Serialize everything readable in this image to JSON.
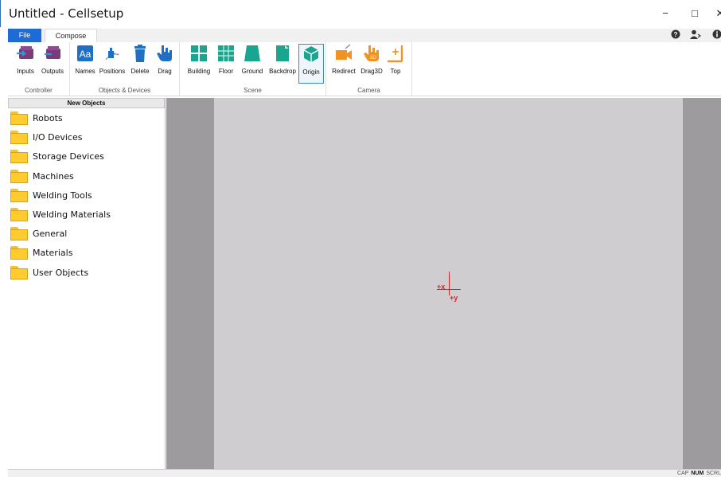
{
  "window": {
    "title": "Untitled - Cellsetup",
    "minimize_glyph": "−",
    "maximize_glyph": "□",
    "close_glyph": "✕"
  },
  "tabs": {
    "file": "File",
    "compose": "Compose"
  },
  "ribbon": {
    "groups": [
      {
        "label": "Controller",
        "buttons": [
          {
            "label": "Inputs",
            "icon": "inputs-icon"
          },
          {
            "label": "Outputs",
            "icon": "outputs-icon"
          }
        ]
      },
      {
        "label": "Objects & Devices",
        "buttons": [
          {
            "label": "Names",
            "icon": "names-icon"
          },
          {
            "label": "Positions",
            "icon": "positions-icon"
          },
          {
            "label": "Delete",
            "icon": "delete-icon"
          },
          {
            "label": "Drag",
            "icon": "drag-icon"
          }
        ]
      },
      {
        "label": "Scene",
        "buttons": [
          {
            "label": "Building",
            "icon": "building-icon"
          },
          {
            "label": "Floor",
            "icon": "floor-icon"
          },
          {
            "label": "Ground",
            "icon": "ground-icon"
          },
          {
            "label": "Backdrop",
            "icon": "backdrop-icon"
          },
          {
            "label": "Origin",
            "icon": "origin-icon",
            "selected": true
          }
        ]
      },
      {
        "label": "Camera",
        "buttons": [
          {
            "label": "Redirect",
            "icon": "redirect-icon"
          },
          {
            "label": "Drag3D",
            "icon": "drag3d-icon"
          },
          {
            "label": "Top",
            "icon": "top-icon"
          }
        ]
      }
    ]
  },
  "left_panel": {
    "header": "New Objects",
    "items": [
      "Robots",
      "I/O Devices",
      "Storage Devices",
      "Machines",
      "Welding Tools",
      "Welding Materials",
      "General",
      "Materials",
      "User Objects"
    ]
  },
  "viewport": {
    "x_axis_label": "+x",
    "y_axis_label": "+y"
  },
  "status": {
    "cap": "CAP",
    "num": "NUM",
    "scrl": "SCRL"
  },
  "colors": {
    "file_tab": "#1c6bd6",
    "teal": "#1aa58e",
    "purple": "#7b3a7a",
    "blue": "#1f6fc5",
    "orange": "#f29321",
    "origin_red": "#e02020"
  }
}
